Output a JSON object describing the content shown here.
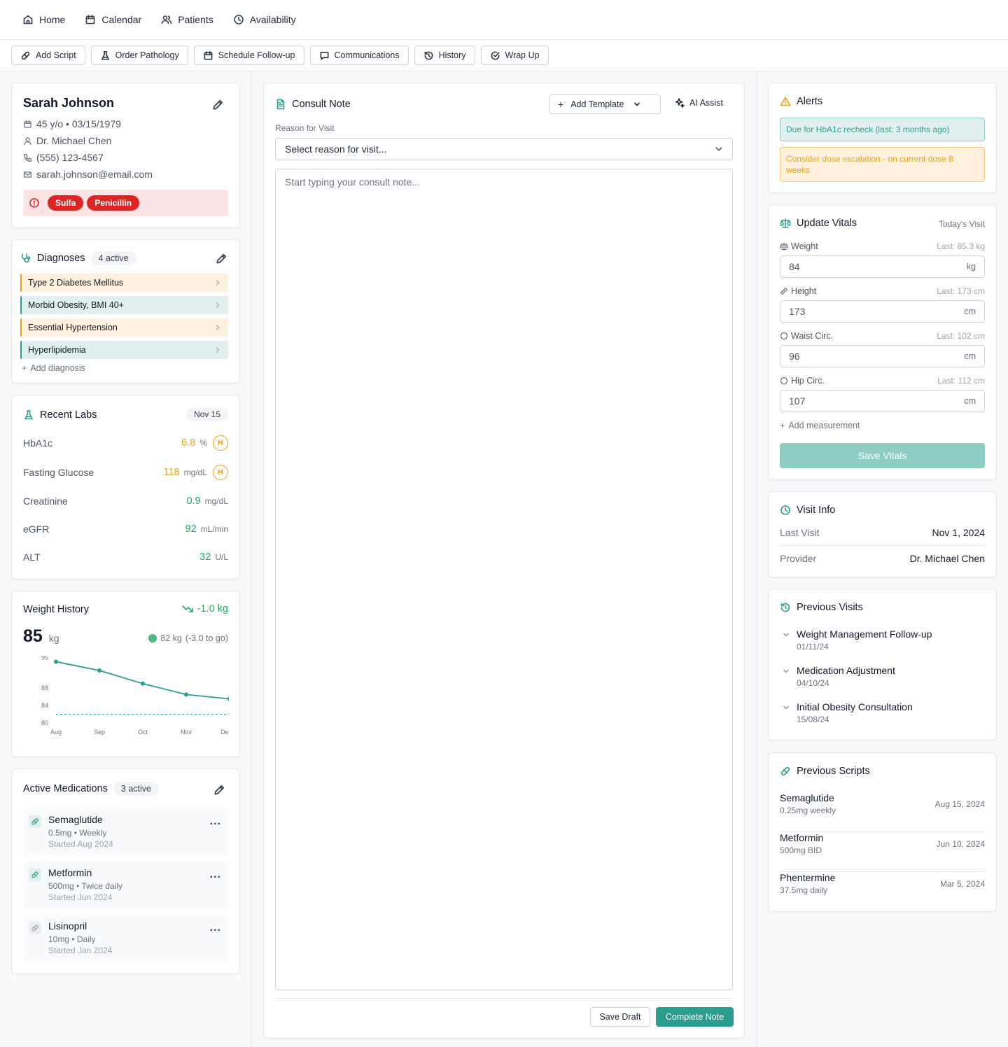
{
  "nav": {
    "home": "Home",
    "calendar": "Calendar",
    "patients": "Patients",
    "availability": "Availability"
  },
  "toolbar": {
    "add_script": "Add Script",
    "order_pathology": "Order Pathology",
    "schedule_followup": "Schedule Follow-up",
    "communications": "Communications",
    "history": "History",
    "wrap_up": "Wrap Up"
  },
  "patient": {
    "name": "Sarah Johnson",
    "age_dob": "45 y/o • 03/15/1979",
    "doctor": "Dr. Michael Chen",
    "phone": "(555) 123-4567",
    "email": "sarah.johnson@email.com",
    "allergies": [
      "Sulfa",
      "Penicillin"
    ]
  },
  "diagnoses": {
    "title": "Diagnoses",
    "badge": "4 active",
    "items": [
      {
        "label": "Type 2 Diabetes Mellitus",
        "color": "#e8a317"
      },
      {
        "label": "Morbid Obesity, BMI 40+",
        "color": "#2a9d8f"
      },
      {
        "label": "Essential Hypertension",
        "color": "#e8a317"
      },
      {
        "label": "Hyperlipidemia",
        "color": "#2a9d8f"
      }
    ],
    "add_label": "Add diagnosis"
  },
  "labs": {
    "title": "Recent Labs",
    "date": "Nov 15",
    "items": [
      {
        "name": "HbA1c",
        "value": "6.8",
        "unit": "%",
        "flag": "H"
      },
      {
        "name": "Fasting Glucose",
        "value": "118",
        "unit": "mg/dL",
        "flag": "H"
      },
      {
        "name": "Creatinine",
        "value": "0.9",
        "unit": "mg/dL",
        "flag": ""
      },
      {
        "name": "eGFR",
        "value": "92",
        "unit": "mL/min",
        "flag": ""
      },
      {
        "name": "ALT",
        "value": "32",
        "unit": "U/L",
        "flag": ""
      }
    ]
  },
  "weight": {
    "title": "Weight History",
    "change": "-1.0 kg",
    "current": "85",
    "unit": "kg",
    "goal": "82 kg",
    "to_go": "(-3.0 to go)"
  },
  "chart_data": {
    "type": "line",
    "x": [
      "Aug",
      "Sep",
      "Oct",
      "Nov",
      "Dec"
    ],
    "series": [
      {
        "values": [
          94,
          92,
          89,
          86.5,
          85.5
        ]
      }
    ],
    "target": 82,
    "yticks": [
      95,
      88,
      84,
      80
    ],
    "ylim": [
      80,
      96
    ]
  },
  "medications": {
    "title": "Active Medications",
    "badge": "3 active",
    "items": [
      {
        "name": "Semaglutide",
        "dose": "0.5mg • Weekly",
        "started": "Started Aug 2024"
      },
      {
        "name": "Metformin",
        "dose": "500mg • Twice daily",
        "started": "Started Jun 2024"
      },
      {
        "name": "Lisinopril",
        "dose": "10mg • Daily",
        "started": "Started Jan 2024"
      }
    ],
    "more": "..."
  },
  "consult": {
    "title": "Consult Note",
    "add_template": "Add Template",
    "ai_assist": "AI Assist",
    "reason_label": "Reason for Visit",
    "reason_placeholder": "Select reason for visit...",
    "note_placeholder": "Start typing your consult note...",
    "save_draft": "Save Draft",
    "complete": "Complete Note"
  },
  "alerts": {
    "title": "Alerts",
    "items": [
      {
        "text": "Due for HbA1c recheck (last: 3 months ago)",
        "type": "info"
      },
      {
        "text": "Consider dose escalation - on current dose 8 weeks",
        "type": "warning"
      }
    ]
  },
  "vitals": {
    "title": "Update Vitals",
    "subtitle": "Today's Visit",
    "items": [
      {
        "label": "Weight",
        "last": "Last: 85.3 kg",
        "value": "84",
        "unit": "kg"
      },
      {
        "label": "Height",
        "last": "Last: 173 cm",
        "value": "173",
        "unit": "cm"
      },
      {
        "label": "Waist Circ.",
        "last": "Last: 102 cm",
        "value": "96",
        "unit": "cm"
      },
      {
        "label": "Hip Circ.",
        "last": "Last: 112 cm",
        "value": "107",
        "unit": "cm"
      }
    ],
    "add_measurement": "Add measurement",
    "save": "Save Vitals"
  },
  "visit_info": {
    "title": "Visit Info",
    "last_visit_label": "Last Visit",
    "last_visit": "Nov 1, 2024",
    "provider_label": "Provider",
    "provider": "Dr. Michael Chen"
  },
  "previous_visits": {
    "title": "Previous Visits",
    "items": [
      {
        "name": "Weight Management Follow-up",
        "date": "01/11/24"
      },
      {
        "name": "Medication Adjustment",
        "date": "04/10/24"
      },
      {
        "name": "Initial Obesity Consultation",
        "date": "15/08/24"
      }
    ]
  },
  "previous_scripts": {
    "title": "Previous Scripts",
    "items": [
      {
        "name": "Semaglutide",
        "dose": "0.25mg weekly",
        "date": "Aug 15, 2024"
      },
      {
        "name": "Metformin",
        "dose": "500mg BID",
        "date": "Jun 10, 2024"
      },
      {
        "name": "Phentermine",
        "dose": "37.5mg daily",
        "date": "Mar 5, 2024"
      }
    ]
  },
  "colors": {
    "accent": "#2a9d8f",
    "warning": "#e8a317",
    "danger": "#dc2626",
    "good": "#22a861"
  }
}
